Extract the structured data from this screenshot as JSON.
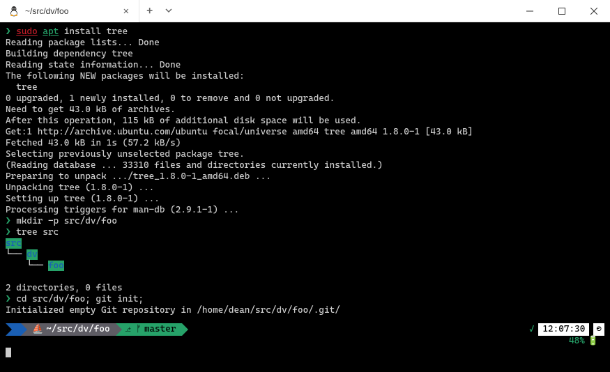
{
  "tab": {
    "title": "~/src/dv/foo"
  },
  "terminal": {
    "lines": [
      {
        "type": "cmd",
        "parts": [
          {
            "cls": "prompt-arrow",
            "text": "❯ "
          },
          {
            "cls": "red-underline",
            "text": "sudo"
          },
          {
            "cls": "",
            "text": " "
          },
          {
            "cls": "green-underline",
            "text": "apt"
          },
          {
            "cls": "",
            "text": " install tree"
          }
        ]
      },
      {
        "type": "out",
        "text": "Reading package lists... Done"
      },
      {
        "type": "out",
        "text": "Building dependency tree"
      },
      {
        "type": "out",
        "text": "Reading state information... Done"
      },
      {
        "type": "out",
        "text": "The following NEW packages will be installed:"
      },
      {
        "type": "out",
        "text": "  tree"
      },
      {
        "type": "out",
        "text": "0 upgraded, 1 newly installed, 0 to remove and 0 not upgraded."
      },
      {
        "type": "out",
        "text": "Need to get 43.0 kB of archives."
      },
      {
        "type": "out",
        "text": "After this operation, 115 kB of additional disk space will be used."
      },
      {
        "type": "out",
        "text": "Get:1 http://archive.ubuntu.com/ubuntu focal/universe amd64 tree amd64 1.8.0-1 [43.0 kB]"
      },
      {
        "type": "out",
        "text": "Fetched 43.0 kB in 1s (57.2 kB/s)"
      },
      {
        "type": "out",
        "text": "Selecting previously unselected package tree."
      },
      {
        "type": "out",
        "text": "(Reading database ... 33310 files and directories currently installed.)"
      },
      {
        "type": "out",
        "text": "Preparing to unpack .../tree_1.8.0-1_amd64.deb ..."
      },
      {
        "type": "out",
        "text": "Unpacking tree (1.8.0-1) ..."
      },
      {
        "type": "out",
        "text": "Setting up tree (1.8.0-1) ..."
      },
      {
        "type": "out",
        "text": "Processing triggers for man-db (2.9.1-1) ..."
      },
      {
        "type": "cmd",
        "parts": [
          {
            "cls": "prompt-arrow",
            "text": "❯ "
          },
          {
            "cls": "",
            "text": "mkdir -p src/dv/foo"
          }
        ]
      },
      {
        "type": "cmd",
        "parts": [
          {
            "cls": "prompt-arrow",
            "text": "❯ "
          },
          {
            "cls": "",
            "text": "tree src"
          }
        ]
      },
      {
        "type": "tree",
        "branch": "",
        "dir": "src"
      },
      {
        "type": "tree",
        "branch": "└── ",
        "dir": "dv"
      },
      {
        "type": "tree",
        "branch": "    └── ",
        "dir": "foo"
      },
      {
        "type": "blank"
      },
      {
        "type": "out",
        "text": "2 directories, 0 files"
      },
      {
        "type": "cmd",
        "parts": [
          {
            "cls": "prompt-arrow",
            "text": "❯ "
          },
          {
            "cls": "",
            "text": "cd src/dv/foo; git init;"
          }
        ]
      },
      {
        "type": "out",
        "text": "Initialized empty Git repository in /home/dean/src/dv/foo/.git/"
      }
    ]
  },
  "statusline": {
    "wsl_icon": "⛵",
    "path": "~/src/dv/foo",
    "branch_icon": "⎇ ᚠ",
    "branch": "master",
    "check": "✓",
    "clock": "12:07:30",
    "clock_icon": "◴",
    "battery_pct": "48%",
    "battery_icon": "🔋"
  }
}
